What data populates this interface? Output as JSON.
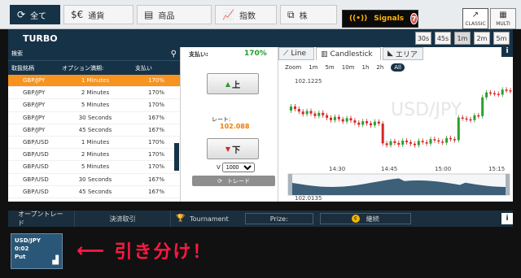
{
  "top_tabs": [
    {
      "label": "全て",
      "icon": "refresh-icon"
    },
    {
      "label": "通貨",
      "icon": "currency-icon"
    },
    {
      "label": "商品",
      "icon": "gold-bars-icon"
    },
    {
      "label": "指数",
      "icon": "chart-icon"
    },
    {
      "label": "株",
      "icon": "shares-icon"
    }
  ],
  "signals": {
    "label": "Signals",
    "count": "7"
  },
  "views": {
    "classic": "CLASSIC",
    "multi": "MULTI"
  },
  "header": {
    "title": "TURBO"
  },
  "timeframes": [
    "30s",
    "45s",
    "1m",
    "2m",
    "5m"
  ],
  "asset_panel": {
    "search_placeholder": "検索",
    "columns": [
      "取扱銘柄",
      "オプション満期:",
      "支払い"
    ],
    "rows": [
      {
        "asset": "GBP/JPY",
        "expiry": "1 Minutes",
        "payout": "170%"
      },
      {
        "asset": "GBP/JPY",
        "expiry": "2 Minutes",
        "payout": "170%"
      },
      {
        "asset": "GBP/JPY",
        "expiry": "5 Minutes",
        "payout": "170%"
      },
      {
        "asset": "GBP/JPY",
        "expiry": "30 Seconds",
        "payout": "167%"
      },
      {
        "asset": "GBP/JPY",
        "expiry": "45 Seconds",
        "payout": "167%"
      },
      {
        "asset": "GBP/USD",
        "expiry": "1 Minutes",
        "payout": "170%"
      },
      {
        "asset": "GBP/USD",
        "expiry": "2 Minutes",
        "payout": "170%"
      },
      {
        "asset": "GBP/USD",
        "expiry": "5 Minutes",
        "payout": "170%"
      },
      {
        "asset": "GBP/USD",
        "expiry": "30 Seconds",
        "payout": "167%"
      },
      {
        "asset": "GBP/USD",
        "expiry": "45 Seconds",
        "payout": "167%"
      }
    ]
  },
  "trade_panel": {
    "payout_label": "支払い:",
    "payout_value": "170%",
    "up_label": "上",
    "down_label": "下",
    "rate_label": "レート:",
    "rate_value": "102.088",
    "amount_prefix": "V",
    "amount_value": "1000",
    "trade_button": "トレード"
  },
  "chart_tabs": [
    {
      "label": "Line"
    },
    {
      "label": "Candlestick"
    },
    {
      "label": "エリア"
    }
  ],
  "zoom": {
    "label": "Zoom",
    "options": [
      "1m",
      "5m",
      "10m",
      "1h",
      "2h",
      "All"
    ]
  },
  "chart_data": {
    "type": "candlestick",
    "watermark": "USD/JPY",
    "y_ticks": [
      "102.1225",
      "102.0135"
    ],
    "x_ticks": [
      "14:30",
      "14:45",
      "15:00",
      "15:15"
    ],
    "y_range": [
      102.0135,
      102.1225
    ],
    "candle_count": 56,
    "colors": {
      "up": "#2ca02c",
      "down": "#d62728"
    }
  },
  "bottom_bar": {
    "tabs": [
      "オープントレード",
      "決済取引"
    ],
    "tournament": "Tournament",
    "prize_label": "Prize:",
    "continue_label": "継続",
    "info": "i"
  },
  "open_trade": {
    "asset": "USD/JPY",
    "time": "0:02",
    "direction": "Put"
  },
  "annotation": {
    "text": "引き分け！"
  }
}
